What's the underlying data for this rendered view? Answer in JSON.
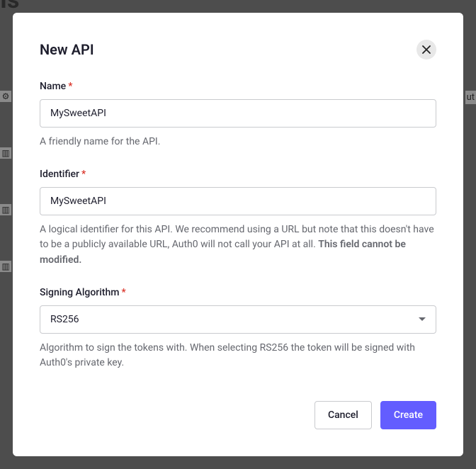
{
  "backdrop": {
    "header_fragment": "Is",
    "right_fragment": "ut"
  },
  "modal": {
    "title": "New API",
    "fields": {
      "name": {
        "label": "Name",
        "value": "MySweetAPI",
        "help": "A friendly name for the API."
      },
      "identifier": {
        "label": "Identifier",
        "value": "MySweetAPI",
        "help_prefix": "A logical identifier for this API. We recommend using a URL but note that this doesn't have to be a publicly available URL, Auth0 will not call your API at all. ",
        "help_bold": "This field cannot be modified."
      },
      "algorithm": {
        "label": "Signing Algorithm",
        "value": "RS256",
        "help": "Algorithm to sign the tokens with. When selecting RS256 the token will be signed with Auth0's private key."
      }
    },
    "buttons": {
      "cancel": "Cancel",
      "create": "Create"
    }
  }
}
